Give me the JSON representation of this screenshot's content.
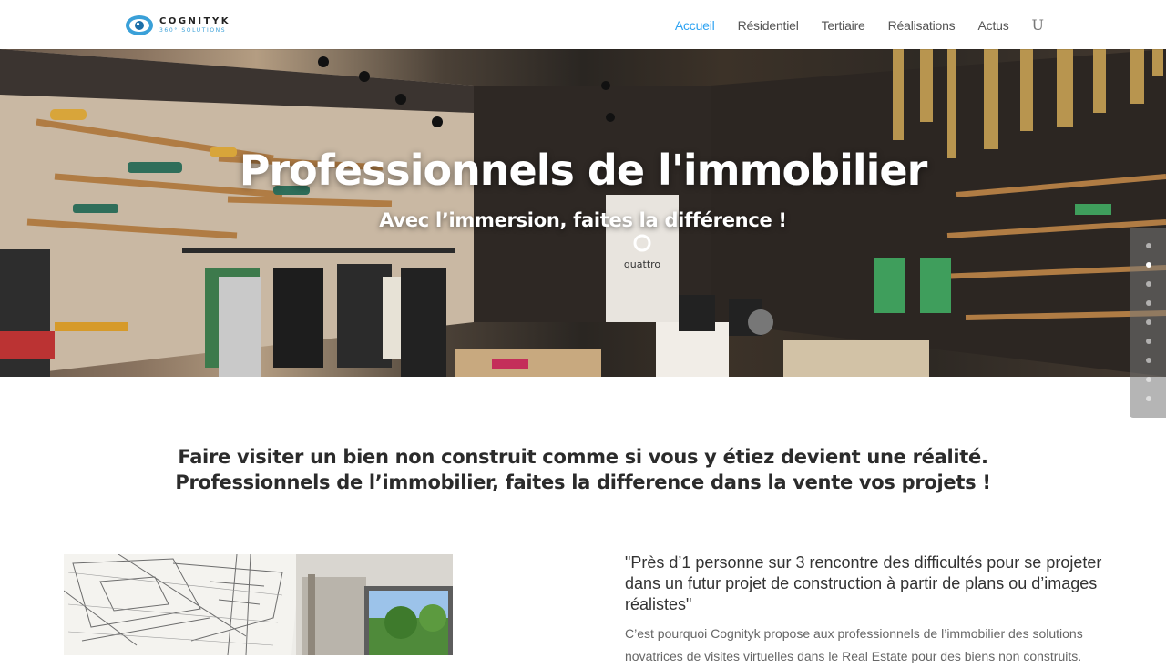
{
  "brand": {
    "name": "COGNITYK",
    "tagline": "360° SOLUTIONS"
  },
  "nav": {
    "items": [
      "Accueil",
      "Résidentiel",
      "Tertiaire",
      "Réalisations",
      "Actus"
    ],
    "active_index": 0,
    "search_glyph": "U"
  },
  "hero": {
    "title": "Professionnels de l'immobilier",
    "subtitle": "Avec l’immersion, faites la différence !",
    "store_sign": "quattro"
  },
  "dotnav": {
    "count": 9,
    "active_index": 1
  },
  "intro": {
    "line1": "Faire visiter un bien non construit comme si vous y étiez devient une réalité.",
    "line2": "Professionnels de l’immobilier, faites la difference dans la vente vos projets !"
  },
  "content": {
    "quote": "\"Près d’1 personne sur 3 rencontre des difficultés pour se projeter dans un futur projet de construction à partir de plans ou d’images réalistes\"",
    "body": "C’est pourquoi Cognityk propose aux professionnels de l’immobilier des solutions novatrices de visites virtuelles dans le Real Estate pour des biens non construits."
  },
  "colors": {
    "accent": "#2ea3f2",
    "logo_blue": "#3aa0d8",
    "text_dark": "#2b2b2b"
  }
}
